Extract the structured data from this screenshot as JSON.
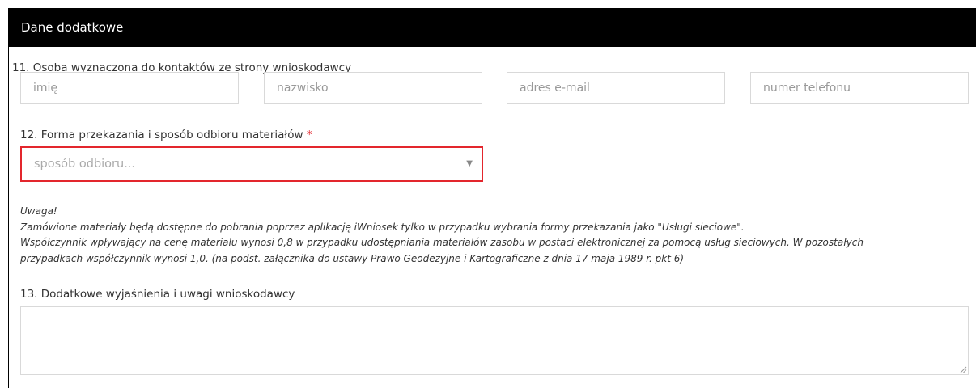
{
  "section": {
    "title": "Dane dodatkowe"
  },
  "contact": {
    "label": "11. Osoba wyznaczona do kontaktów ze strony wnioskodawcy",
    "first_name_placeholder": "imię",
    "last_name_placeholder": "nazwisko",
    "email_placeholder": "adres e-mail",
    "phone_placeholder": "numer telefonu"
  },
  "delivery": {
    "label": "12. Forma przekazania i sposób odbioru materiałów",
    "required_mark": "*",
    "select_value": "sposób odbioru..."
  },
  "note": {
    "title": "Uwaga!",
    "line1": "Zamówione materiały będą dostępne do pobrania poprzez aplikację iWniosek tylko w przypadku wybrania formy przekazania jako \"Usługi sieciowe\".",
    "line2": "Współczynnik wpływający na cenę materiału wynosi 0,8 w przypadku udostępniania materiałów zasobu w postaci elektronicznej za pomocą usług sieciowych. W pozostałych",
    "line3": "przypadkach współczynnik wynosi 1,0. (na podst. załącznika do ustawy Prawo Geodezyjne i Kartograficzne z dnia 17 maja 1989 r. pkt 6)"
  },
  "remarks": {
    "label": "13. Dodatkowe wyjaśnienia i uwagi wnioskodawcy",
    "value": ""
  },
  "colors": {
    "header_bg": "#000000",
    "required": "#e3262d",
    "input_border": "#d9d9d9"
  }
}
